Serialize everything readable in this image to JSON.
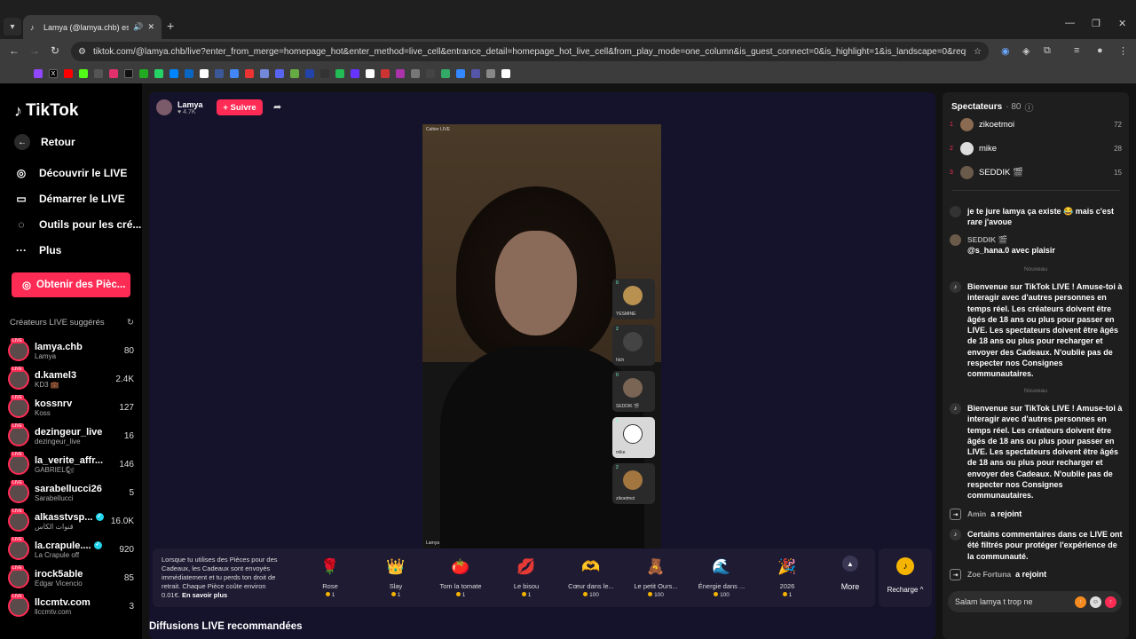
{
  "browser": {
    "tab_title": "Lamya (@lamya.chb) est en",
    "url": "tiktok.com/@lamya.chb/live?enter_from_merge=homepage_hot&enter_method=live_cell&entrance_detail=homepage_hot_live_cell&from_play_mode=one_column&is_guest_connect=0&is_highlight=1&is_landscape=0&request_id=2026..."
  },
  "sidebar": {
    "logo": "TikTok",
    "back": "Retour",
    "nav": [
      {
        "label": "Découvrir le LIVE",
        "icon": "camera-icon"
      },
      {
        "label": "Démarrer le LIVE",
        "icon": "video-icon"
      },
      {
        "label": "Outils pour les cré...",
        "icon": "tools-icon"
      },
      {
        "label": "Plus",
        "icon": "more-icon"
      }
    ],
    "coins_button": "Obtenir des Pièc...",
    "suggested_header": "Créateurs LIVE suggérés",
    "creators": [
      {
        "name": "lamya.chb",
        "sub": "Lamya",
        "count": "80"
      },
      {
        "name": "d.kamel3",
        "sub": "KD3 💼",
        "count": "2.4K"
      },
      {
        "name": "kossnrv",
        "sub": "Koss",
        "count": "127"
      },
      {
        "name": "dezingeur_live",
        "sub": "dezingeur_live",
        "count": "16"
      },
      {
        "name": "la_verite_affr...",
        "sub": "GABRIEL🐿",
        "count": "146"
      },
      {
        "name": "sarabellucci26",
        "sub": "Sarabellucci",
        "count": "5"
      },
      {
        "name": "alkasstvsp...",
        "sub": "قنوات الكأس",
        "count": "16.0K",
        "verified": true
      },
      {
        "name": "la.crapule....",
        "sub": "La Crapule off",
        "count": "920",
        "verified": true
      },
      {
        "name": "irock5able",
        "sub": "Edgar Vicencio",
        "count": "85"
      },
      {
        "name": "llccmtv.com",
        "sub": "llccmtv.com",
        "count": "3"
      }
    ]
  },
  "stream": {
    "host_name": "Lamya",
    "host_likes": "♥ 4.7K",
    "follow_button": "+ Suivre",
    "video_tag": "Cahier LIVE",
    "video_name": "Lamya",
    "guests": [
      {
        "name": "YESMINE",
        "count": "0"
      },
      {
        "name": "hlch",
        "count": "2"
      },
      {
        "name": "SEDDIK 🎬",
        "count": "0"
      },
      {
        "name": "mike",
        "count": "6"
      },
      {
        "name": "zikoetmoi",
        "count": "2"
      }
    ],
    "gift_info": "Lorsque tu utilises des Pièces pour des Cadeaux, les Cadeaux sont envoyés immédiatement et tu perds ton droit de retrait. Chaque Pièce coûte environ 0.01€.",
    "gift_info_link": "En savoir plus",
    "gifts": [
      {
        "name": "Rose",
        "price": "1",
        "icon": "🌹"
      },
      {
        "name": "Slay",
        "price": "1",
        "icon": "👑"
      },
      {
        "name": "Tom la tomate",
        "price": "1",
        "icon": "🍅"
      },
      {
        "name": "Le bisou",
        "price": "1",
        "icon": "💋"
      },
      {
        "name": "Cœur dans le...",
        "price": "100",
        "icon": "🫶"
      },
      {
        "name": "Le petit Ours...",
        "price": "100",
        "icon": "🧸"
      },
      {
        "name": "Énergie dans ...",
        "price": "100",
        "icon": "🌊"
      },
      {
        "name": "2026",
        "price": "1",
        "icon": "🎉"
      }
    ],
    "more_label": "More",
    "recharge_label": "Recharge ^",
    "recommended": "Diffusions LIVE recommandées"
  },
  "chat": {
    "viewers_label": "Spectateurs",
    "viewers_count": "· 80",
    "top_viewers": [
      {
        "rank": "1",
        "name": "zikoetmoi",
        "score": "72"
      },
      {
        "rank": "2",
        "name": "mike",
        "score": "28"
      },
      {
        "rank": "3",
        "name": "SEDDIK 🎬",
        "score": "15"
      }
    ],
    "messages": [
      {
        "text": "je te jure lamya ça existe 😂 mais c'est rare j'avoue"
      },
      {
        "user": "SEDDIK 🎬",
        "text": "@s_hana.0 avec plaisir"
      }
    ],
    "new_label": "Nouveau",
    "welcome": "Bienvenue sur TikTok LIVE ! Amuse-toi à interagir avec d'autres personnes en temps réel. Les créateurs doivent être âgés de 18 ans ou plus pour passer en LIVE. Les spectateurs doivent être âgés de 18 ans ou plus pour recharger et envoyer des Cadeaux. N'oublie pas de respecter nos Consignes communautaires.",
    "joined_1_user": "Amin",
    "joined_1_text": "a rejoint",
    "filtered": "Certains commentaires dans ce LIVE ont été filtrés pour protéger l'expérience de la communauté.",
    "joined_2_user": "Zoe Fortuna",
    "joined_2_text": "a rejoint",
    "input_value": "Salam lamya t trop ne"
  }
}
